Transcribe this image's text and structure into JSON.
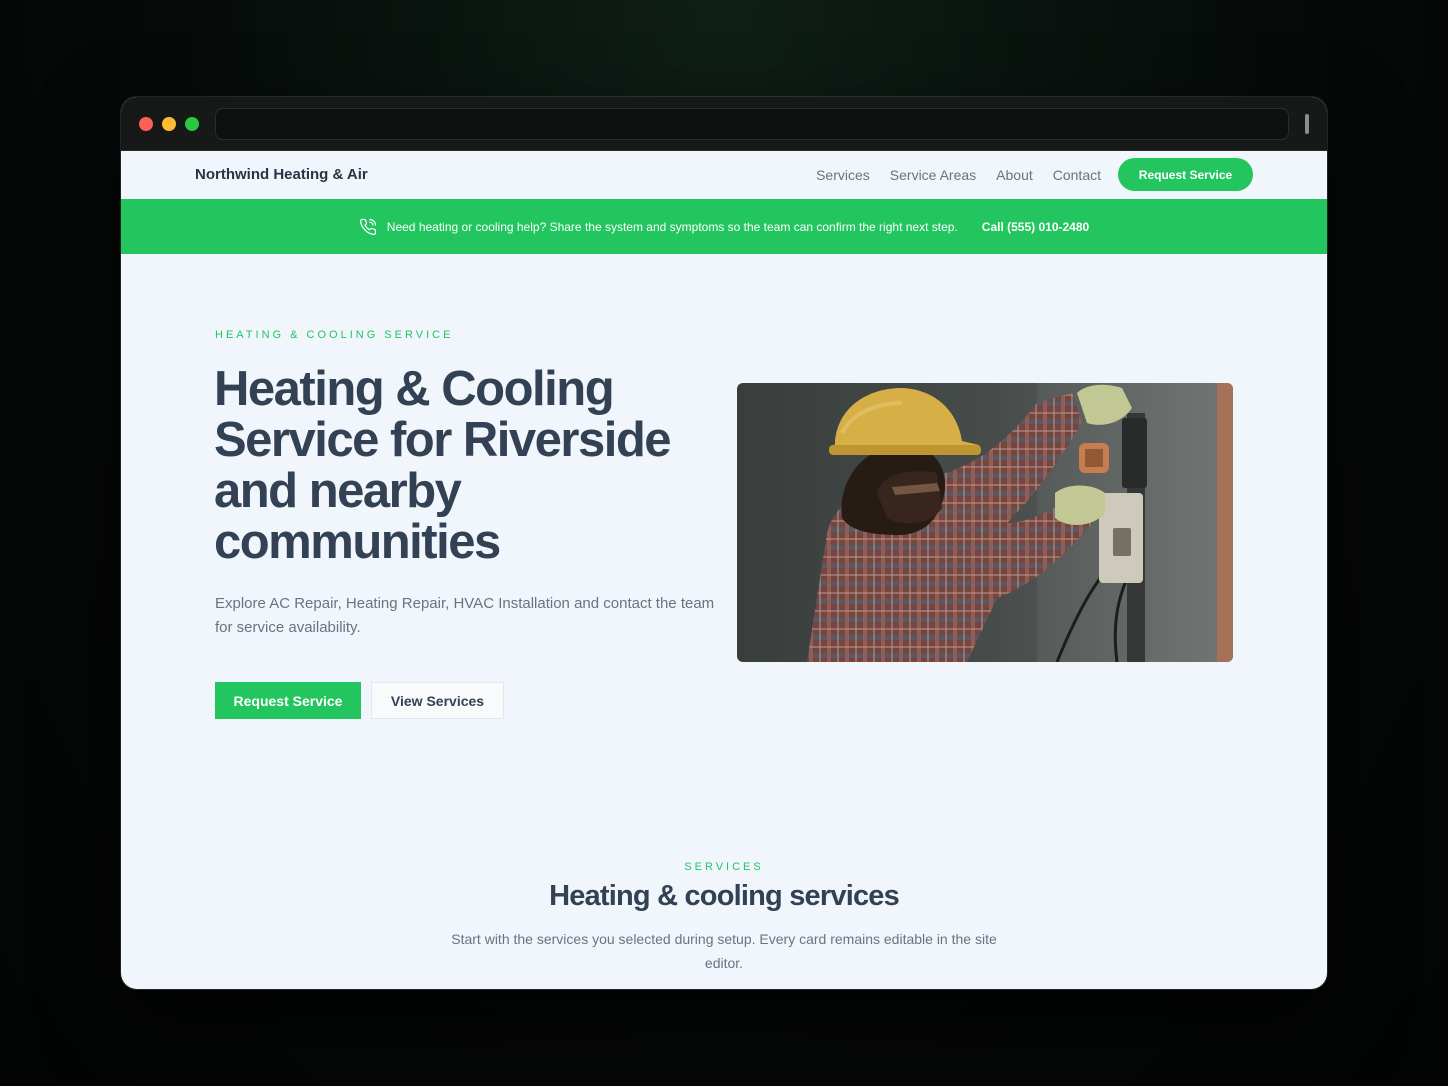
{
  "browser": {
    "url": ""
  },
  "nav": {
    "brand": "Northwind Heating & Air",
    "links": [
      "Services",
      "Service Areas",
      "About",
      "Contact"
    ],
    "cta": "Request Service"
  },
  "banner": {
    "icon": "phone-icon",
    "message": "Need heating or cooling help? Share the system and symptoms so the team can confirm the right next step.",
    "call": "Call (555) 010-2480"
  },
  "hero": {
    "eyebrow": "HEATING & COOLING SERVICE",
    "title": "Heating & Cooling Service for Riverside and nearby communities",
    "description": "Explore AC Repair, Heating Repair, HVAC Installation and contact the team for service availability.",
    "primary_button": "Request Service",
    "secondary_button": "View Services"
  },
  "services": {
    "eyebrow": "SERVICES",
    "title": "Heating & cooling services",
    "description": "Start with the services you selected during setup. Every card remains editable in the site editor."
  },
  "colors": {
    "accent": "#22c55e",
    "heading": "#334155",
    "body_text": "#6b7280",
    "page_bg": "#f1f6fc"
  }
}
